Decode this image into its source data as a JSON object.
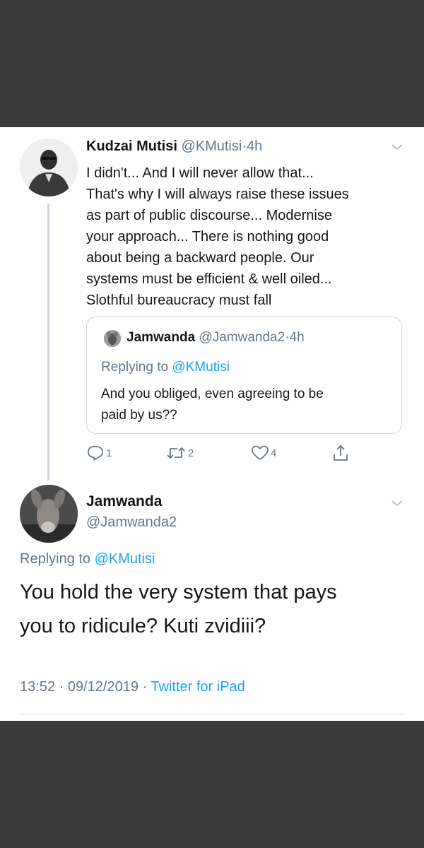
{
  "main_tweet": {
    "author_name": "Kudzai Mutisi",
    "author_handle": "@KMutisi",
    "separator": "·",
    "time": "4h",
    "body_lines": [
      "I didn't... And I will never allow that...",
      "That's why I will always raise these issues",
      "as part of public discourse... Modernise",
      "your approach... There is nothing good",
      "about being a backward people. Our",
      "systems must be efficient & well oiled...",
      "Slothful bureaucracy must fall"
    ],
    "quoted": {
      "author_name": "Jamwanda",
      "author_handle": "@Jamwanda2",
      "separator": "·",
      "time": "4h",
      "replying_prefix": "Replying to ",
      "replying_handle": "@KMutisi",
      "body_lines": [
        "And you obliged, even agreeing to be",
        "paid by us??"
      ]
    },
    "actions": {
      "reply_count": "1",
      "retweet_count": "2",
      "like_count": "4"
    },
    "icons": {
      "reply": "reply-icon",
      "retweet": "retweet-icon",
      "like": "heart-icon",
      "share": "share-icon",
      "menu": "chevron-down-icon"
    }
  },
  "reply_tweet": {
    "author_name": "Jamwanda",
    "author_handle": "@Jamwanda2",
    "replying_prefix": "Replying to ",
    "replying_handle": "@KMutisi",
    "body_lines": [
      "You hold the very system that pays",
      "you to ridicule? Kuti zvidiii?"
    ],
    "time": "13:52",
    "separator": "·",
    "date": "09/12/2019",
    "source": "Twitter for iPad"
  },
  "colors": {
    "background_band": "#3a3a3a",
    "card": "#ffffff",
    "text": "#14171a",
    "muted": "#657786",
    "link": "#1da1f2",
    "border": "#ccd6dd"
  }
}
